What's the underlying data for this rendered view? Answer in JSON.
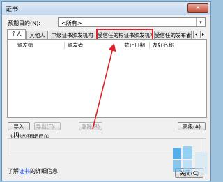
{
  "window": {
    "title": "证书",
    "close_glyph": "✕"
  },
  "purpose": {
    "label": "预期目的(N):",
    "value": "<所有>",
    "arrow": "▾"
  },
  "tabs": [
    {
      "label": "个人"
    },
    {
      "label": "其他人"
    },
    {
      "label": "中级证书颁发机构"
    },
    {
      "label": "受信任的根证书颁发机构"
    },
    {
      "label": "受信任的发布者"
    }
  ],
  "tab_scroll": {
    "left": "◂",
    "right": "▸"
  },
  "columns": [
    "颁发给",
    "颁发者",
    "截止日期",
    "友好名称"
  ],
  "buttons": {
    "import": "导入(I)...",
    "export": "导出(E)...",
    "remove": "删除(R)",
    "advanced": "高级(A)"
  },
  "cert_purpose_label": "证书的预期目的",
  "footer": {
    "prefix": "了解",
    "link": "证书",
    "suffix": "的详细信息"
  },
  "close_button": "关闭(C)",
  "colors": {
    "highlight": "#d8232a",
    "link": "#1a4fcf"
  }
}
